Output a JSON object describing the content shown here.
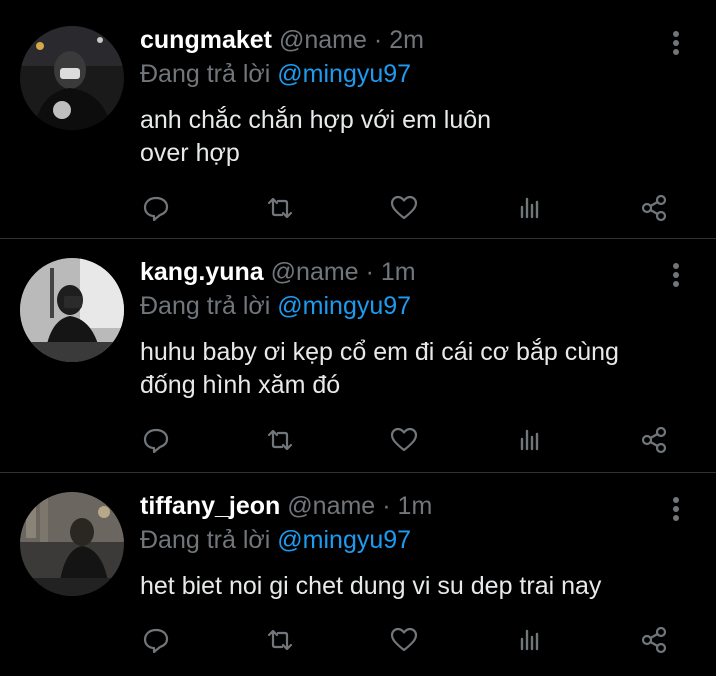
{
  "tweets": [
    {
      "username": "cungmaket",
      "handle": "@name",
      "separator": "·",
      "time": "2m",
      "reply_prefix": "Đang trả lời",
      "reply_to": "@mingyu97",
      "lines": [
        "anh chắc chắn hợp với em luôn",
        "over hợp"
      ]
    },
    {
      "username": "kang.yuna",
      "handle": "@name",
      "separator": "·",
      "time": "1m",
      "reply_prefix": "Đang trả lời",
      "reply_to": "@mingyu97",
      "lines": [
        "huhu baby ơi kẹp cổ em đi cái cơ bắp cùng",
        "đống hình xăm đó"
      ]
    },
    {
      "username": "tiffany_jeon",
      "handle": "@name",
      "separator": "·",
      "time": "1m",
      "reply_prefix": "Đang trả lời",
      "reply_to": "@mingyu97",
      "lines": [
        "het biet noi gi chet dung vi su dep trai nay"
      ]
    }
  ],
  "icons": {
    "reply": "reply-icon",
    "retweet": "retweet-icon",
    "like": "like-icon",
    "views": "views-icon",
    "share": "share-icon",
    "more": "more-icon"
  },
  "colors": {
    "background": "#000000",
    "muted": "#71767b",
    "link": "#1d9bf0",
    "divider": "#2f3336"
  }
}
